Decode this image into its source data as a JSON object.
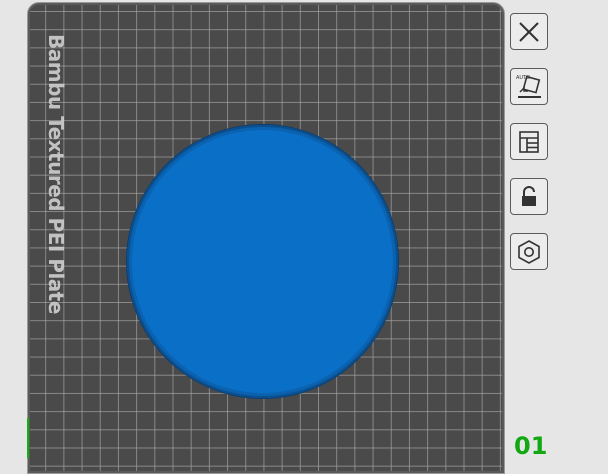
{
  "plate": {
    "label": "Bambu Textured PEI Plate",
    "index": "01",
    "object_color": "#0a6fc6",
    "grid_color": "#4a4a4a"
  },
  "toolbar": {
    "buttons": [
      {
        "name": "close-button",
        "icon": "close-icon"
      },
      {
        "name": "auto-orient-button",
        "icon": "auto-orient-icon",
        "badge": "AUTO"
      },
      {
        "name": "arrange-button",
        "icon": "layout-icon"
      },
      {
        "name": "lock-plate-button",
        "icon": "lock-icon"
      },
      {
        "name": "plate-settings-button",
        "icon": "hex-nut-icon"
      }
    ]
  },
  "colors": {
    "axis": "#10b010",
    "background": "#e6e6e6"
  }
}
